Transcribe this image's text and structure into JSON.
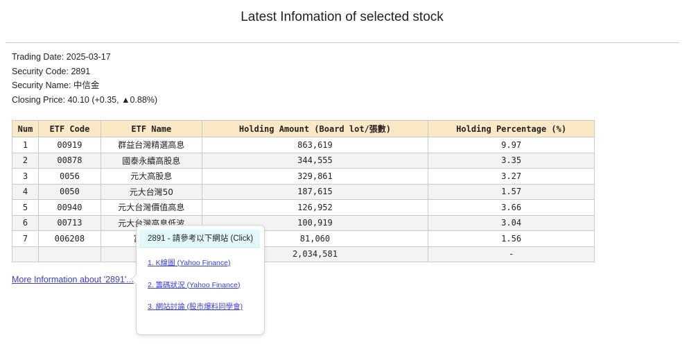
{
  "page": {
    "title": "Latest Infomation of selected stock"
  },
  "info": {
    "trading_date": "Trading Date: 2025-03-17",
    "security_code": "Security Code: 2891",
    "security_name": "Security Name: 中信金",
    "closing_price": "Closing Price: 40.10 (+0.35, ▲0.88%)"
  },
  "table": {
    "headers": [
      "Num",
      "ETF Code",
      "ETF Name",
      "Holding Amount (Board lot/張數)",
      "Holding Percentage (%)"
    ],
    "rows": [
      [
        "1",
        "00919",
        "群益台灣精選高息",
        "863,619",
        "9.97"
      ],
      [
        "2",
        "00878",
        "國泰永續高股息",
        "344,555",
        "3.35"
      ],
      [
        "3",
        "0056",
        "元大高股息",
        "329,861",
        "3.27"
      ],
      [
        "4",
        "0050",
        "元大台灣50",
        "187,615",
        "1.57"
      ],
      [
        "5",
        "00940",
        "元大台灣價值高息",
        "126,952",
        "3.66"
      ],
      [
        "6",
        "00713",
        "元大台灣高息低波",
        "100,919",
        "3.04"
      ],
      [
        "7",
        "006208",
        "富邦台50",
        "81,060",
        "1.56"
      ]
    ],
    "total": [
      "",
      "",
      "",
      "2,034,581",
      "-"
    ]
  },
  "more_link": "More Information about '2891'...",
  "popup": {
    "header": "2891 - 請參考以下網站 (Click)",
    "links": [
      "1. K線圖 (Yahoo Finance)",
      "2. 籌碼狀況 (Yahoo Finance)",
      "3. 網站討論 (股市爆料同學會)"
    ]
  }
}
